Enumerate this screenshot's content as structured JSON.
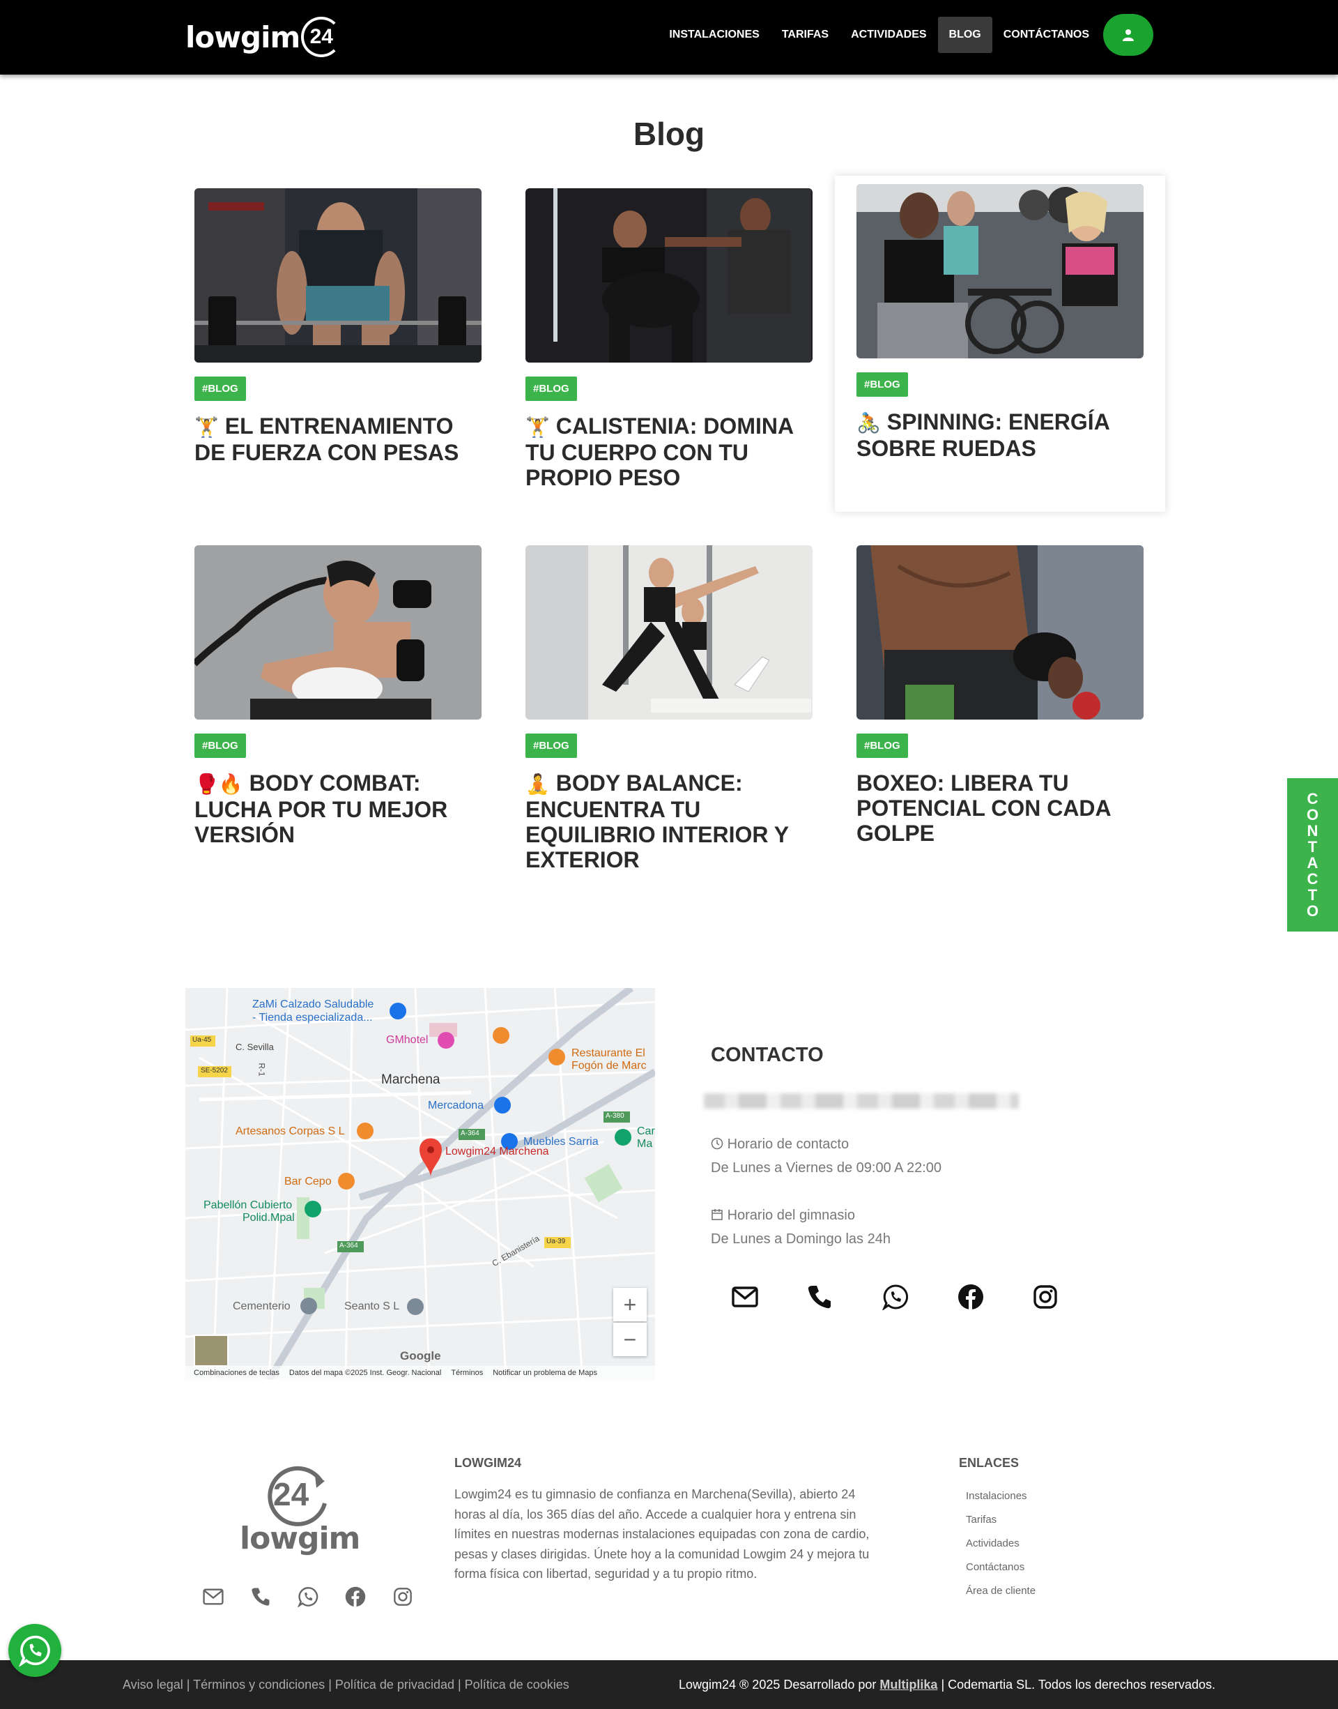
{
  "header": {
    "logo_text": "lowgim",
    "logo_number": "24",
    "nav": [
      {
        "label": "INSTALACIONES"
      },
      {
        "label": "TARIFAS"
      },
      {
        "label": "ACTIVIDADES"
      },
      {
        "label": "BLOG",
        "active": true
      },
      {
        "label": "CONTÁCTANOS"
      }
    ],
    "user_icon": "user-icon"
  },
  "blog": {
    "title": "Blog",
    "posts": [
      {
        "tag": "#BLOG",
        "emoji": "🏋️",
        "title": "EL ENTRENAMIENTO DE FUERZA CON PESAS"
      },
      {
        "tag": "#BLOG",
        "emoji": "🏋️",
        "title": "CALISTENIA: DOMINA TU CUERPO CON TU PROPIO PESO"
      },
      {
        "tag": "#BLOG",
        "emoji": "🚴",
        "title": "SPINNING: ENERGÍA SOBRE RUEDAS"
      },
      {
        "tag": "#BLOG",
        "emoji": "🥊🔥",
        "title": "BODY COMBAT: LUCHA POR TU MEJOR VERSIÓN"
      },
      {
        "tag": "#BLOG",
        "emoji": "🧘",
        "title": "BODY BALANCE: ENCUENTRA TU EQUILIBRIO INTERIOR Y EXTERIOR"
      },
      {
        "tag": "#BLOG",
        "emoji": "",
        "title": "BOXEO: LIBERA TU POTENCIAL CON CADA GOLPE"
      }
    ]
  },
  "contact_tab": "CONTACTO",
  "map": {
    "places": [
      "ZaMi Calzado Saludable",
      "- Tienda especializada...",
      "GMhotel",
      "Restaurante El",
      "Fogón de Marc",
      "C. Sevilla",
      "Marchena",
      "Mercadona",
      "Artesanos Corpas S L",
      "Muebles Sarria",
      "Lowgim24 Marchena",
      "Bar Cepo",
      "Pabellón Cubierto",
      "Polid.Mpal",
      "C. Ebanistería",
      "Cementerio",
      "Seanto S L",
      "Car",
      "Ma"
    ],
    "road_labels": [
      "Ua-45",
      "SE-5202",
      "A-380",
      "A-364",
      "A-364",
      "Ua-39",
      "R-1"
    ],
    "zoom_in": "+",
    "zoom_out": "−",
    "google": "Google",
    "footer": [
      "Combinaciones de teclas",
      "Datos del mapa ©2025 Inst. Geogr. Nacional",
      "Términos",
      "Notificar un problema de Maps"
    ]
  },
  "contact": {
    "title": "CONTACTO",
    "hours_contact_label": "Horario de contacto",
    "hours_contact_value": "De Lunes a Viernes de 09:00 A 22:00",
    "hours_gym_label": "Horario del gimnasio",
    "hours_gym_value": "De Lunes a Domingo las 24h",
    "social": [
      "envelope-icon",
      "phone-icon",
      "whatsapp-icon",
      "facebook-icon",
      "instagram-icon"
    ]
  },
  "footer": {
    "about_title": "LOWGIM24",
    "about_text": "Lowgim24 es tu gimnasio de confianza en Marchena(Sevilla), abierto 24 horas al día, los 365 días del año. Accede a cualquier hora y entrena sin límites en nuestras modernas instalaciones equipadas con zona de cardio, pesas y clases dirigidas. Únete hoy a la comunidad Lowgim 24 y mejora tu forma física con libertad, seguridad y a tu propio ritmo.",
    "links_title": "ENLACES",
    "links": [
      "Instalaciones",
      "Tarifas",
      "Actividades",
      "Contáctanos",
      "Área de cliente"
    ],
    "logo_number": "24",
    "logo_text": "lowgim"
  },
  "bottom": {
    "legal": [
      "Aviso legal",
      "Términos y condiciones",
      "Política de privacidad",
      "Política de cookies"
    ],
    "separator": " | ",
    "copy_prefix": "Lowgim24 ® 2025 Desarrollado por ",
    "copy_link": "Multiplika",
    "copy_suffix": " | Codemartia SL. Todos los derechos reservados."
  },
  "colors": {
    "green": "#3cb44b",
    "header_bg": "#000000",
    "user_btn": "#1aa32e",
    "bottom_bg": "#222222"
  }
}
